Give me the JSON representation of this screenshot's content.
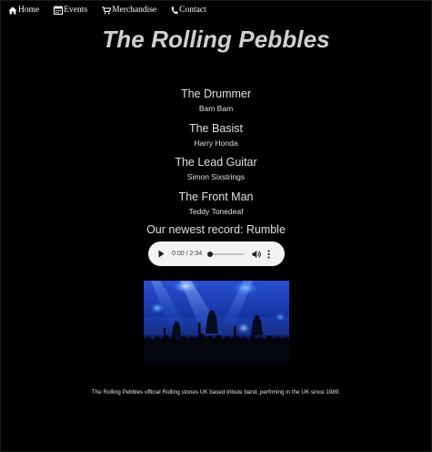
{
  "nav": {
    "items": [
      {
        "label": "Home",
        "icon": "home-icon"
      },
      {
        "label": "Events",
        "icon": "calendar-icon"
      },
      {
        "label": "Merchandise",
        "icon": "cart-icon"
      },
      {
        "label": "Contact",
        "icon": "phone-icon"
      }
    ]
  },
  "header": {
    "title": "The Rolling Pebbles"
  },
  "members": [
    {
      "role": "The Drummer",
      "name": "Bam Bam"
    },
    {
      "role": "The Basist",
      "name": "Harry Honda"
    },
    {
      "role": "The Lead Guitar",
      "name": "Simon Sixstrings"
    },
    {
      "role": "The Front Man",
      "name": "Teddy Tonedeaf"
    }
  ],
  "record": {
    "heading": "Our newest record: Rumble"
  },
  "audio": {
    "time_display": "0:00 / 2:34",
    "progress": 0
  },
  "footer": {
    "text": "The Rolling Pebbles official Rolling stones UK based tribute band, perfrming in the UK since 1989."
  },
  "colors": {
    "background": "#000000",
    "text": "#e0e0e0",
    "title": "#d0d0d0",
    "player_bg": "#f1f3f4"
  }
}
